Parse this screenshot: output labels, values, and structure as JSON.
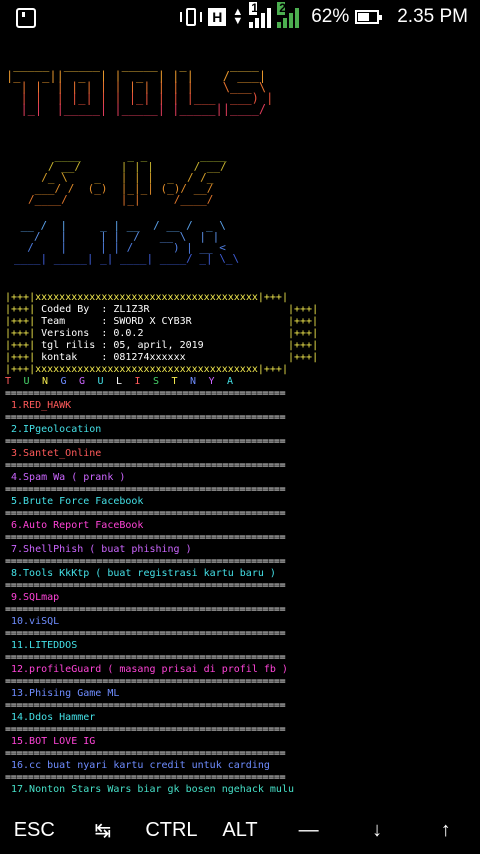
{
  "status": {
    "network_type": "H",
    "sim1": "1",
    "sim2": "2",
    "battery_percent": "62%",
    "battery_level": 0.62,
    "time": "2.35 PM",
    "icons": [
      "notification-box-icon",
      "vibrate-icon",
      "signal-icon",
      "battery-icon"
    ]
  },
  "banner": {
    "tools_art": [
      " _____  _____   _____   _      ____",
      "|_   _||  _  | |  _  | | |    / ___|",
      "  | |  | | | | | | | | | |    \\___ \\",
      "  | |  | |_| | | |_| | | |___  ___) |",
      "  |_|  |_____| |_____| |_____||____/",
      ""
    ],
    "ver_art": [
      "    ____       _ _        ____",
      "   / __/      | | |      / __/",
      "  /_ \\    _   | | |  _  / /_",
      " ___/ /  (_)  |_|_| (_)/ __/",
      "/____/        |_|     /____/"
    ],
    "name_art": [
      " __ /  |     _ | __  / __ /  _ \\",
      "   /   |     | |  /   __ \\  | |",
      "  /    |     | | /      ) | __ <",
      "____| _____| _| ____| ____/ _| \\_\\",
      ""
    ]
  },
  "info": {
    "border": "|+++|xxxxxxxxxxxxxxxxxxxxxxxxxxxxxxxxxxxxx|+++|",
    "rows": [
      {
        "label": "Coded By ",
        "value": "ZL1Z3R"
      },
      {
        "label": "Team     ",
        "value": "SWORD X CYB3R"
      },
      {
        "label": "Versions ",
        "value": "0.0.2"
      },
      {
        "label": "tgl rilis",
        "value": "05, april, 2019"
      },
      {
        "label": "kontak   ",
        "value": "081274xxxxxx"
      }
    ]
  },
  "menu_title": [
    "T",
    "U",
    "N",
    "G",
    "G",
    "U",
    "L",
    "I",
    "S",
    "T",
    "N",
    "Y",
    "A"
  ],
  "menu_title_colors": [
    "#ff5a5a",
    "#46d36a",
    "#f2e94e",
    "#6f8dff",
    "#cc66ff",
    "#44e0e6",
    "#ffffff",
    "#ff5a5a",
    "#46d36a",
    "#f2e94e",
    "#6f8dff",
    "#cc66ff",
    "#44e0e6"
  ],
  "separator": "=================================================",
  "menu": [
    {
      "label": "1.RED_HAWK",
      "color": "red"
    },
    {
      "label": "2.IPgeolocation",
      "color": "cyan"
    },
    {
      "label": "3.Santet_Online",
      "color": "red"
    },
    {
      "label": "4.Spam Wa ( prank )",
      "color": "purple"
    },
    {
      "label": "5.Brute Force Facebook",
      "color": "cyan"
    },
    {
      "label": "6.Auto Report FaceBook",
      "color": "magenta"
    },
    {
      "label": "7.ShellPhish ( buat phishing )",
      "color": "purple"
    },
    {
      "label": "8.Tools KkKtp ( buat registrasi kartu baru )",
      "color": "cyan"
    },
    {
      "label": "9.SQLmap",
      "color": "magenta"
    },
    {
      "label": "10.viSQL",
      "color": "blue"
    },
    {
      "label": "11.LITEDDOS",
      "color": "cyan"
    },
    {
      "label": "12.profileGuard ( masang prisai di profil fb )",
      "color": "magenta"
    },
    {
      "label": "13.Phising Game ML",
      "color": "blue"
    },
    {
      "label": "14.Ddos Hammer",
      "color": "cyan"
    },
    {
      "label": "15.BOT LOVE IG",
      "color": "magenta"
    },
    {
      "label": "16.cc buat nyari kartu credit untuk carding",
      "color": "blue"
    },
    {
      "label": "17.Nonton Stars Wars biar gk bosen ngehack mulu",
      "color": "teal"
    }
  ],
  "keys": [
    "ESC",
    "↹",
    "CTRL",
    "ALT",
    "—",
    "↓",
    "↑"
  ]
}
